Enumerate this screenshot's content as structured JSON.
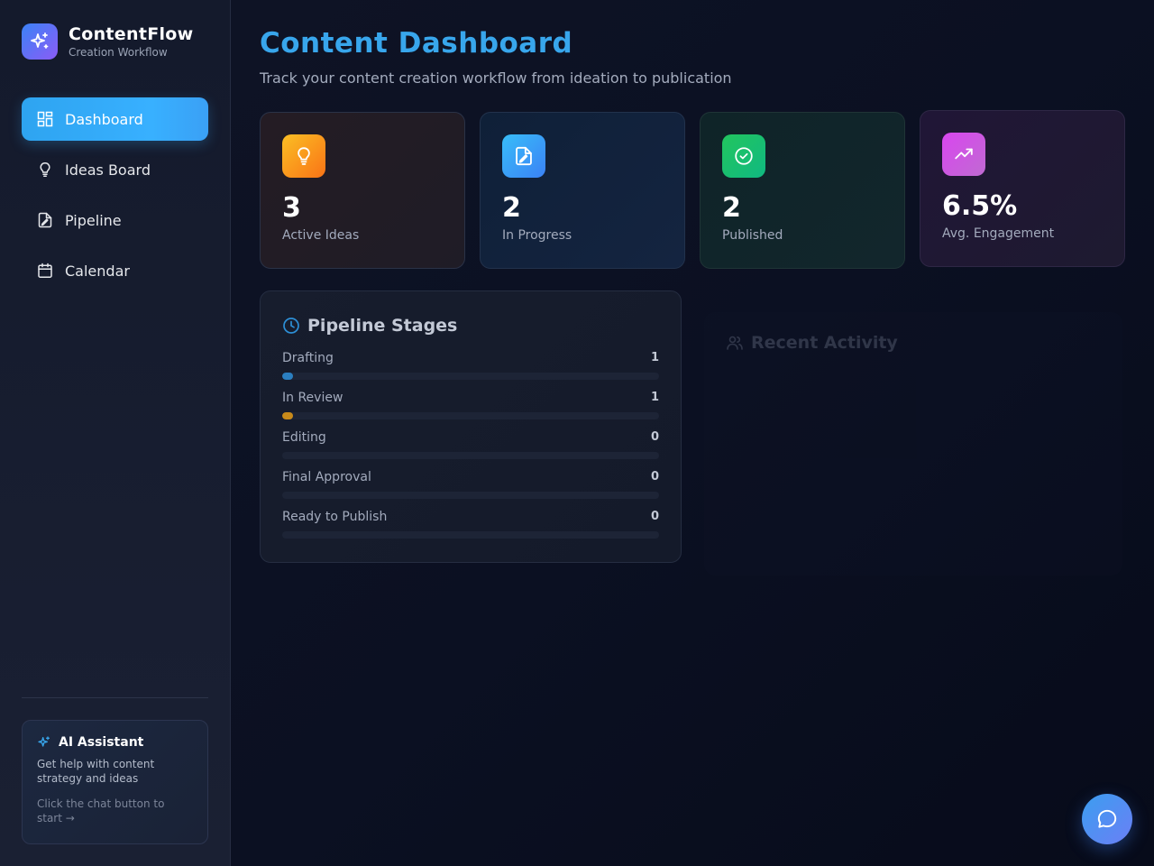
{
  "brand": {
    "title": "ContentFlow",
    "subtitle": "Creation Workflow",
    "icon": "sparkles-icon"
  },
  "nav": {
    "items": [
      {
        "label": "Dashboard",
        "icon": "dashboard-grid-icon",
        "active": true
      },
      {
        "label": "Ideas Board",
        "icon": "lightbulb-icon",
        "active": false
      },
      {
        "label": "Pipeline",
        "icon": "file-edit-icon",
        "active": false
      },
      {
        "label": "Calendar",
        "icon": "calendar-icon",
        "active": false
      }
    ]
  },
  "ai_assistant": {
    "title": "AI Assistant",
    "description": "Get help with content strategy and ideas",
    "hint": "Click the chat button to start →",
    "icon": "sparkles-icon"
  },
  "header": {
    "title": "Content Dashboard",
    "subtitle": "Track your content creation workflow from ideation to publication"
  },
  "stats": [
    {
      "value": "3",
      "label": "Active Ideas",
      "icon": "lightbulb-icon",
      "color": "#f59e0b"
    },
    {
      "value": "2",
      "label": "In Progress",
      "icon": "file-edit-icon",
      "color": "#3b9ef0"
    },
    {
      "value": "2",
      "label": "Published",
      "icon": "check-circle-icon",
      "color": "#22c55e"
    },
    {
      "value": "6.5%",
      "label": "Avg. Engagement",
      "icon": "trending-up-icon",
      "color": "#c55fd6"
    }
  ],
  "pipeline": {
    "title": "Pipeline Stages",
    "icon": "clock-icon",
    "total_scale": 36,
    "stages": [
      {
        "label": "Drafting",
        "count": "1",
        "value": 1,
        "color": "#2b7fc0"
      },
      {
        "label": "In Review",
        "count": "1",
        "value": 1,
        "color": "#c88a1a"
      },
      {
        "label": "Editing",
        "count": "0",
        "value": 0,
        "color": "#2b7fc0"
      },
      {
        "label": "Final Approval",
        "count": "0",
        "value": 0,
        "color": "#2b7fc0"
      },
      {
        "label": "Ready to Publish",
        "count": "0",
        "value": 0,
        "color": "#2b7fc0"
      }
    ]
  },
  "activity": {
    "title": "Recent Activity",
    "icon": "users-icon"
  },
  "chat": {
    "icon": "chat-bubble-icon"
  }
}
